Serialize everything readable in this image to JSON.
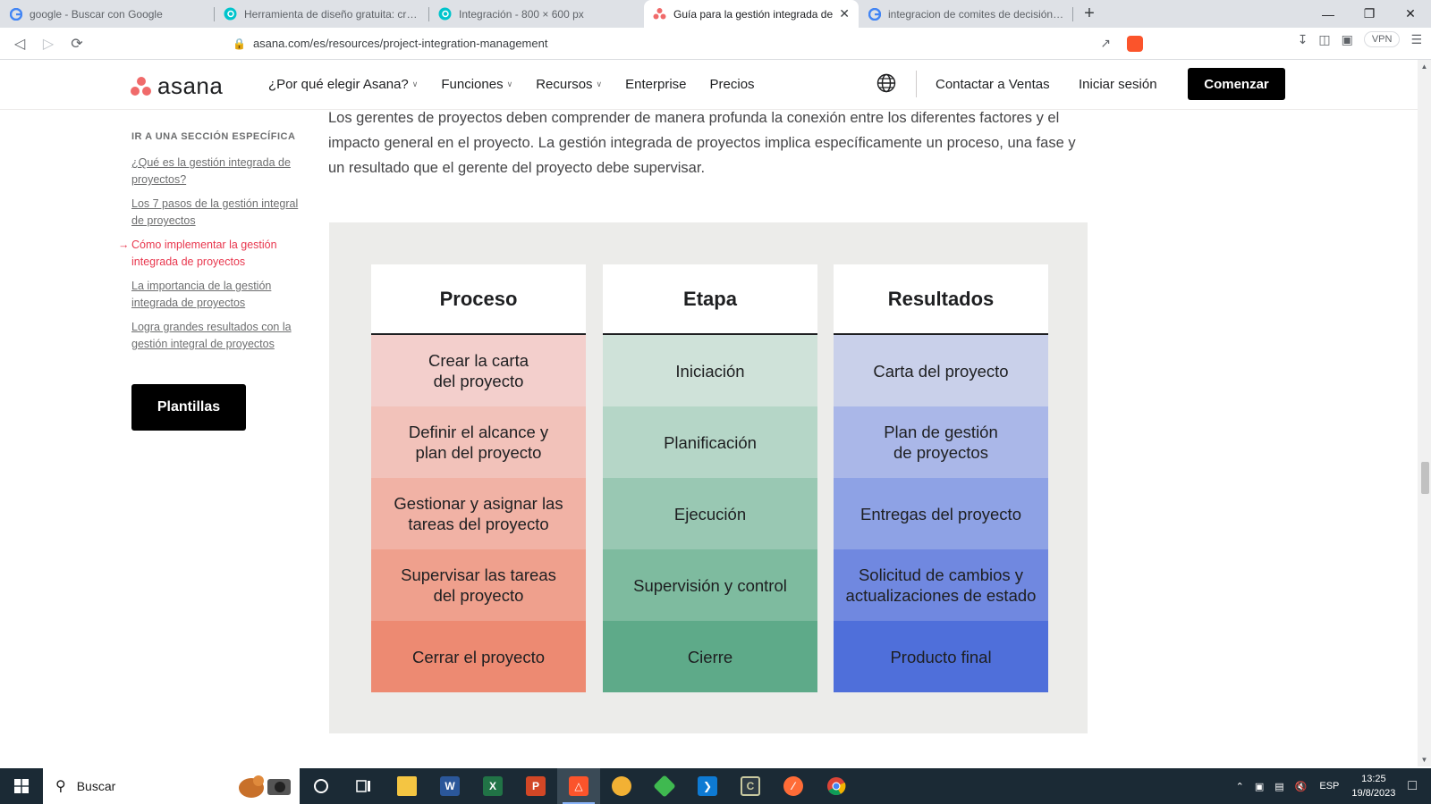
{
  "browser": {
    "tabs": [
      {
        "title": "google - Buscar con Google",
        "icon": "google-icon",
        "active": false
      },
      {
        "title": "Herramienta de diseño gratuita: crea p",
        "icon": "canva-icon",
        "active": false
      },
      {
        "title": "Integración - 800 × 600 px",
        "icon": "canva-icon",
        "active": false
      },
      {
        "title": "Guía para la gestión integrada de",
        "icon": "asana-icon",
        "active": true
      },
      {
        "title": "integracion de comites de decisión - B",
        "icon": "google-icon",
        "active": false
      }
    ],
    "new_tab_symbol": "+",
    "url": "asana.com/es/resources/project-integration-management",
    "vpn_label": "VPN"
  },
  "site_header": {
    "logo_text": "asana",
    "nav": [
      {
        "label": "¿Por qué elegir Asana?",
        "dropdown": true
      },
      {
        "label": "Funciones",
        "dropdown": true
      },
      {
        "label": "Recursos",
        "dropdown": true
      },
      {
        "label": "Enterprise",
        "dropdown": false
      },
      {
        "label": "Precios",
        "dropdown": false
      }
    ],
    "contact_sales": "Contactar a Ventas",
    "login": "Iniciar sesión",
    "cta": "Comenzar"
  },
  "sidebar": {
    "title": "IR A UNA SECCIÓN ESPECÍFICA",
    "links": [
      {
        "label": "¿Qué es la gestión integrada de proyectos?",
        "active": false
      },
      {
        "label": "Los 7 pasos de la gestión integral de proyectos",
        "active": false
      },
      {
        "label": "Cómo implementar la gestión integrada de proyectos",
        "active": true
      },
      {
        "label": "La importancia de la gestión integrada de proyectos",
        "active": false
      },
      {
        "label": "Logra grandes resultados con la gestión integral de proyectos",
        "active": false
      }
    ],
    "templates_button": "Plantillas"
  },
  "main": {
    "intro": "Los gerentes de proyectos deben comprender de manera profunda la conexión entre los diferentes factores y el impacto general en el proyecto. La gestión integrada de proyectos implica específicamente un proceso, una fase y un resultado que el gerente del proyecto debe supervisar."
  },
  "table": {
    "columns": [
      {
        "header": "Proceso",
        "colors": [
          "#f3cfcc",
          "#f2c2ba",
          "#f1b2a5",
          "#efa08d",
          "#ed8a72"
        ],
        "cells": [
          "Crear la carta\ndel proyecto",
          "Definir el alcance y\nplan del proyecto",
          "Gestionar y asignar las\ntareas del proyecto",
          "Supervisar las tareas\ndel proyecto",
          "Cerrar el proyecto"
        ]
      },
      {
        "header": "Etapa",
        "colors": [
          "#cfe2d9",
          "#b5d6c7",
          "#99c8b3",
          "#7ebb9f",
          "#5eaa89"
        ],
        "cells": [
          "Iniciación",
          "Planificación",
          "Ejecución",
          "Supervisión y control",
          "Cierre"
        ]
      },
      {
        "header": "Resultados",
        "colors": [
          "#c9d0ea",
          "#aab7e8",
          "#8ea2e5",
          "#7088e0",
          "#4f6fda"
        ],
        "cells": [
          "Carta del proyecto",
          "Plan de gestión\nde proyectos",
          "Entregas del proyecto",
          "Solicitud de cambios y\nactualizaciones de estado",
          "Producto final"
        ]
      }
    ]
  },
  "taskbar": {
    "search_placeholder": "Buscar",
    "language": "ESP",
    "time": "13:25",
    "date": "19/8/2023"
  }
}
